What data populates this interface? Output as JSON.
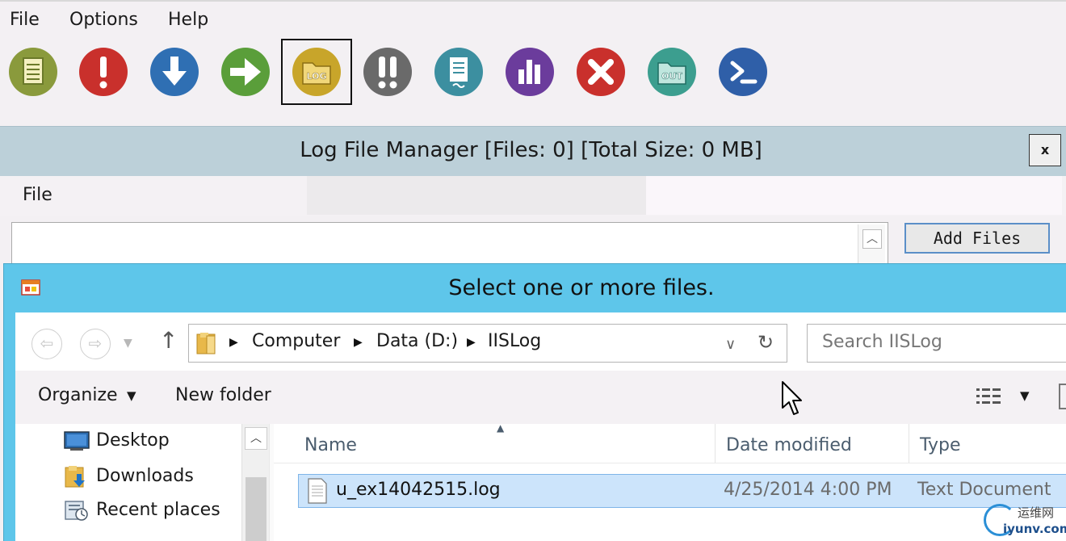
{
  "menu": {
    "file": "File",
    "options": "Options",
    "help": "Help"
  },
  "toolbar": {
    "buttons": [
      {
        "icon": "document-icon",
        "color": "#8a9a3c"
      },
      {
        "icon": "exclamation-icon",
        "color": "#c9302c"
      },
      {
        "icon": "download-arrow-icon",
        "color": "#2f6fb3"
      },
      {
        "icon": "right-arrow-icon",
        "color": "#5a9e3a"
      },
      {
        "icon": "log-folder-icon",
        "color": "#c8a52a",
        "label": "LOG",
        "selected": true
      },
      {
        "icon": "double-exclamation-icon",
        "color": "#6a6a6a"
      },
      {
        "icon": "text-file-icon",
        "color": "#3c8fa0"
      },
      {
        "icon": "bar-chart-icon",
        "color": "#6b3c9c"
      },
      {
        "icon": "close-x-icon",
        "color": "#c9302c"
      },
      {
        "icon": "out-folder-icon",
        "color": "#3c9e8f",
        "label": "OUT"
      },
      {
        "icon": "powershell-icon",
        "color": "#2f5fa8"
      }
    ]
  },
  "log_manager": {
    "title": "Log File Manager [Files: 0] [Total Size: 0 MB]",
    "close": "x",
    "menu_file": "File",
    "add_files": "Add Files"
  },
  "dialog": {
    "title": "Select one or more files.",
    "breadcrumb": [
      "Computer",
      "Data (D:)",
      "IISLog"
    ],
    "search_placeholder": "Search IISLog",
    "organize": "Organize",
    "new_folder": "New folder",
    "nav_items": [
      {
        "label": "Desktop",
        "icon": "desktop-icon"
      },
      {
        "label": "Downloads",
        "icon": "downloads-icon"
      },
      {
        "label": "Recent places",
        "icon": "recent-places-icon"
      }
    ],
    "columns": {
      "name": "Name",
      "date": "Date modified",
      "type": "Type"
    },
    "files": [
      {
        "name": "u_ex14042515.log",
        "date": "4/25/2014 4:00 PM",
        "type": "Text Document"
      }
    ]
  },
  "watermark": {
    "cn": "运维网",
    "en": "iyunv.com"
  }
}
